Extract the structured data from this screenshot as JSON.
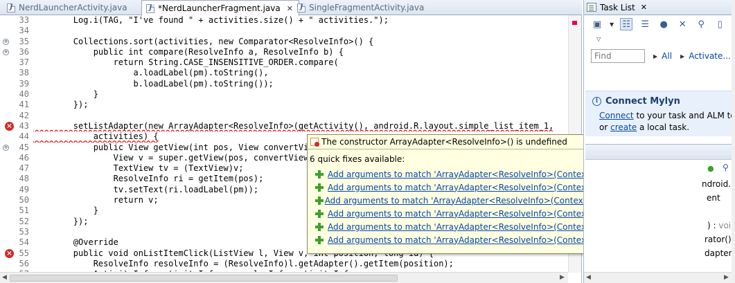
{
  "editor": {
    "tabs": [
      {
        "label": "NerdLauncherActivity.java",
        "active": false
      },
      {
        "label": "*NerdLauncherFragment.java",
        "active": true
      },
      {
        "label": "SingleFragmentActivity.java",
        "active": false
      }
    ],
    "close_glyph": "✕",
    "lines": [
      {
        "num": "33",
        "text": "        Log.i(TAG, \"I've found \" + activities.size() + \" activities.\");"
      },
      {
        "num": "34",
        "text": ""
      },
      {
        "num": "35",
        "text": "        Collections.sort(activities, new Comparator<ResolveInfo>() {",
        "marker": "fold"
      },
      {
        "num": "36",
        "text": "            public int compare(ResolveInfo a, ResolveInfo b) {",
        "marker": "fold-warn"
      },
      {
        "num": "37",
        "text": "                return String.CASE_INSENSITIVE_ORDER.compare("
      },
      {
        "num": "38",
        "text": "                    a.loadLabel(pm).toString(),"
      },
      {
        "num": "39",
        "text": "                    b.loadLabel(pm).toString());"
      },
      {
        "num": "40",
        "text": "            }"
      },
      {
        "num": "41",
        "text": "        });"
      },
      {
        "num": "42",
        "text": ""
      },
      {
        "num": "43",
        "text": "        setListAdapter(new ArrayAdapter<ResolveInfo>(getActivity(), android.R.layout.simple_list_item_1,",
        "marker": "error-warn"
      },
      {
        "num": "44",
        "text": "            activities) {"
      },
      {
        "num": "45",
        "text": "            public View getView(int pos, View convertView, ViewGroup parent) {",
        "marker": "fold-warn"
      },
      {
        "num": "46",
        "text": "                View v = super.getView(pos, convertView, parent);"
      },
      {
        "num": "47",
        "text": "                TextView tv = (TextView)v;"
      },
      {
        "num": "48",
        "text": "                ResolveInfo ri = getItem(pos);"
      },
      {
        "num": "49",
        "text": "                tv.setText(ri.loadLabel(pm));"
      },
      {
        "num": "50",
        "text": "                return v;"
      },
      {
        "num": "51",
        "text": "            }"
      },
      {
        "num": "52",
        "text": "        });"
      },
      {
        "num": "53",
        "text": ""
      },
      {
        "num": "54",
        "text": "        @Override"
      },
      {
        "num": "55",
        "text": "        public void onListItemClick(ListView l, View v, int position, long id) {",
        "marker": "error"
      },
      {
        "num": "56",
        "text": "            ResolveInfo resolveInfo = (ResolveInfo)l.getAdapter().getItem(position);"
      },
      {
        "num": "57",
        "text": "            ActivityInfo activityInfo = resolveInfo.activityInfo;"
      }
    ]
  },
  "quickfix": {
    "title": "The constructor ArrayAdapter<ResolveInfo>() is undefined",
    "count_text": "6 quick fixes available:",
    "fixes": [
      "Add arguments to match 'ArrayAdapter<ResolveInfo>(Context, int)'",
      "Add arguments to match 'ArrayAdapter<ResolveInfo>(Context, int, int)'",
      "Add arguments to match 'ArrayAdapter<ResolveInfo>(Context, int, int, List<ResolveInfo>)'",
      "Add arguments to match 'ArrayAdapter<ResolveInfo>(Context, int, int, ResolveInfo[])'",
      "Add arguments to match 'ArrayAdapter<ResolveInfo>(Context, int, List<ResolveInfo>)'",
      "Add arguments to match 'ArrayAdapter<ResolveInfo>(Context, int, ResolveInfo[])'"
    ]
  },
  "tasklist": {
    "title": "Task List",
    "close_glyph": "✕",
    "find_placeholder": "Find",
    "all_label": "All",
    "activate_label": "Activate...",
    "mylyn_title": "Connect Mylyn",
    "connect_link": "Connect",
    "connect_rest": " to your task and ALM to",
    "or_text": "or ",
    "create_link": "create",
    "create_rest": " a local task."
  },
  "outline_fragments": {
    "line1": "ndroid.",
    "line2": "ent",
    "line3a": ") : ",
    "line3b": "voi",
    "line4": "rator()",
    "line5": "dapter("
  }
}
